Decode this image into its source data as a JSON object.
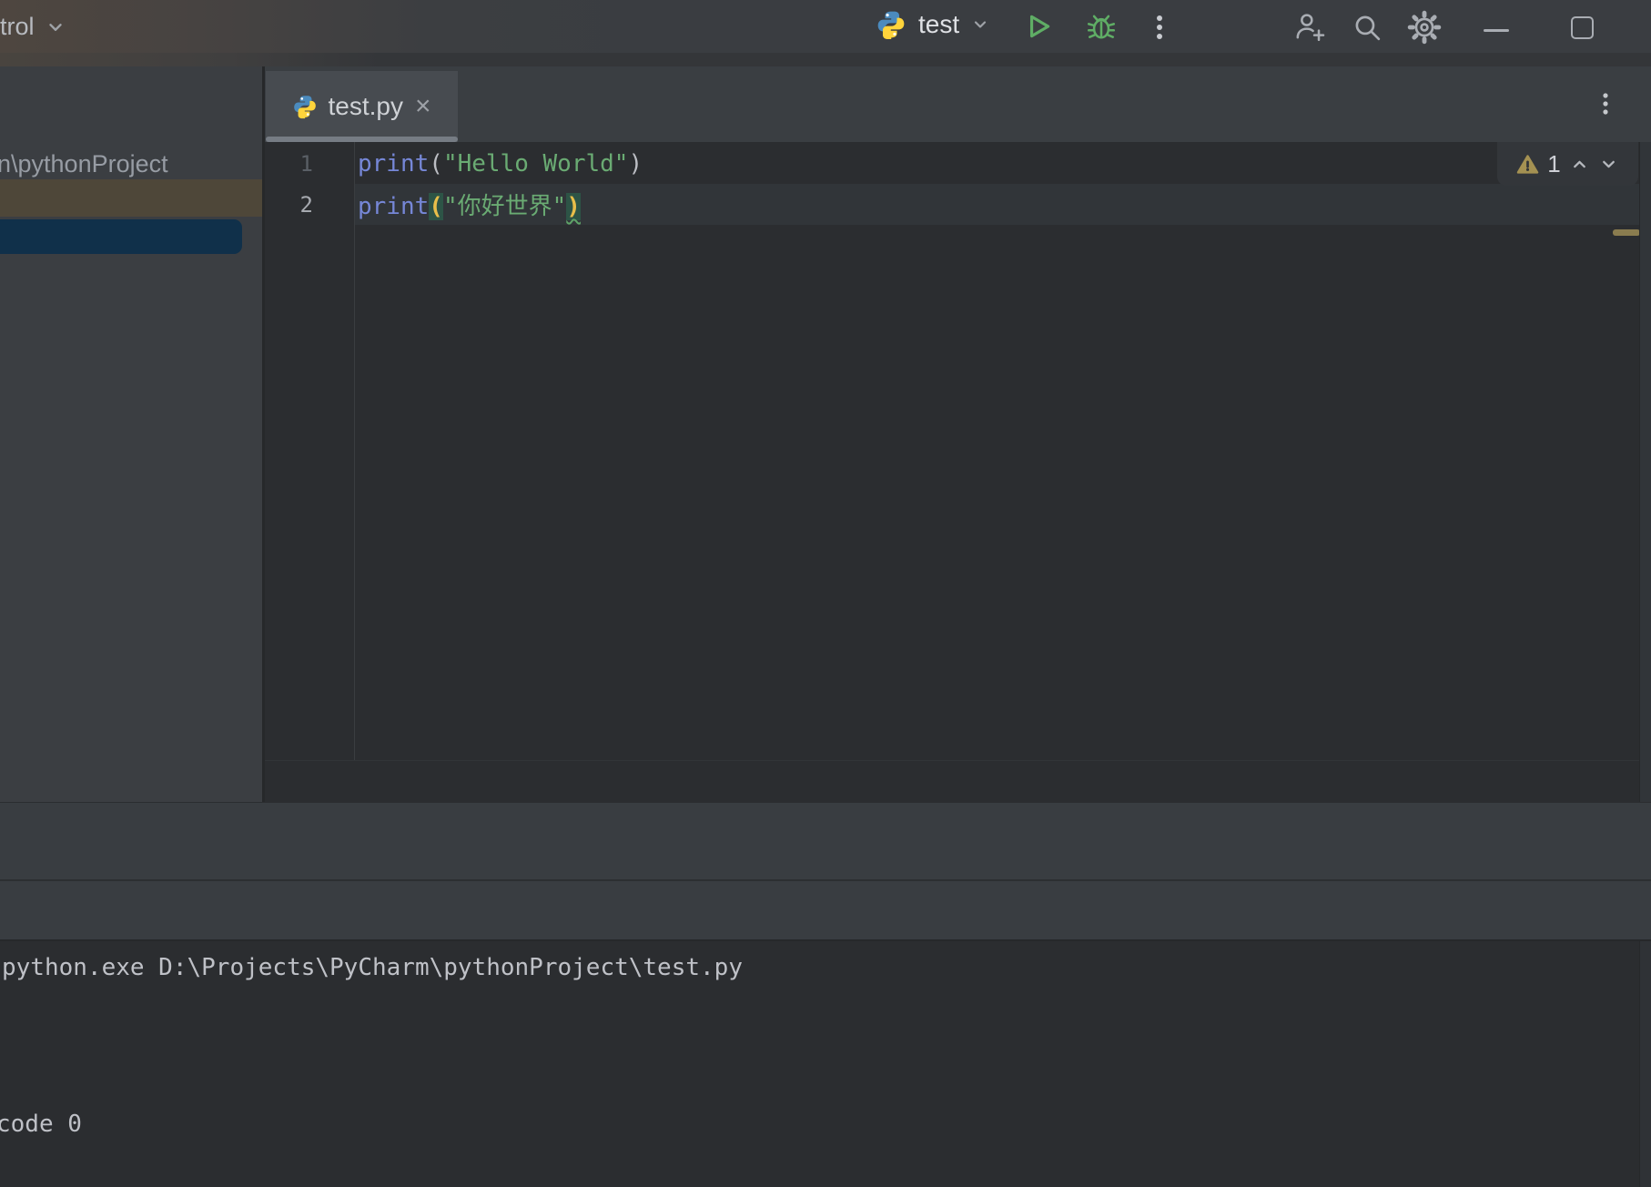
{
  "titlebar": {
    "vcs_label": "trol",
    "run_config_label": "test"
  },
  "tabbar": {
    "active_tab": "test.py",
    "close_glyph": "×"
  },
  "project_panel": {
    "visible_path_text": "n\\pythonProject"
  },
  "editor": {
    "inspection_count": "1",
    "line1": {
      "num": "1",
      "kw": "print",
      "open": "(",
      "str": "\"Hello World\"",
      "close": ")"
    },
    "line2": {
      "num": "2",
      "kw": "print",
      "open": "(",
      "q1": "\"",
      "str": "你好世界",
      "q2": "\"",
      "close": ")"
    }
  },
  "console": {
    "command_tail": "python.exe D:\\Projects\\PyCharm\\pythonProject\\test.py",
    "exit_tail": "code 0"
  },
  "colors": {
    "accent_green": "#5FAD65",
    "warning_olive": "#A49152",
    "selection_blue": "#10304A",
    "hover_olive": "#4E4739",
    "match_paren_bg": "#2D5446",
    "string_green": "#6AAB73",
    "function_blue": "#7687D7",
    "tab_underline": "#767C84"
  }
}
